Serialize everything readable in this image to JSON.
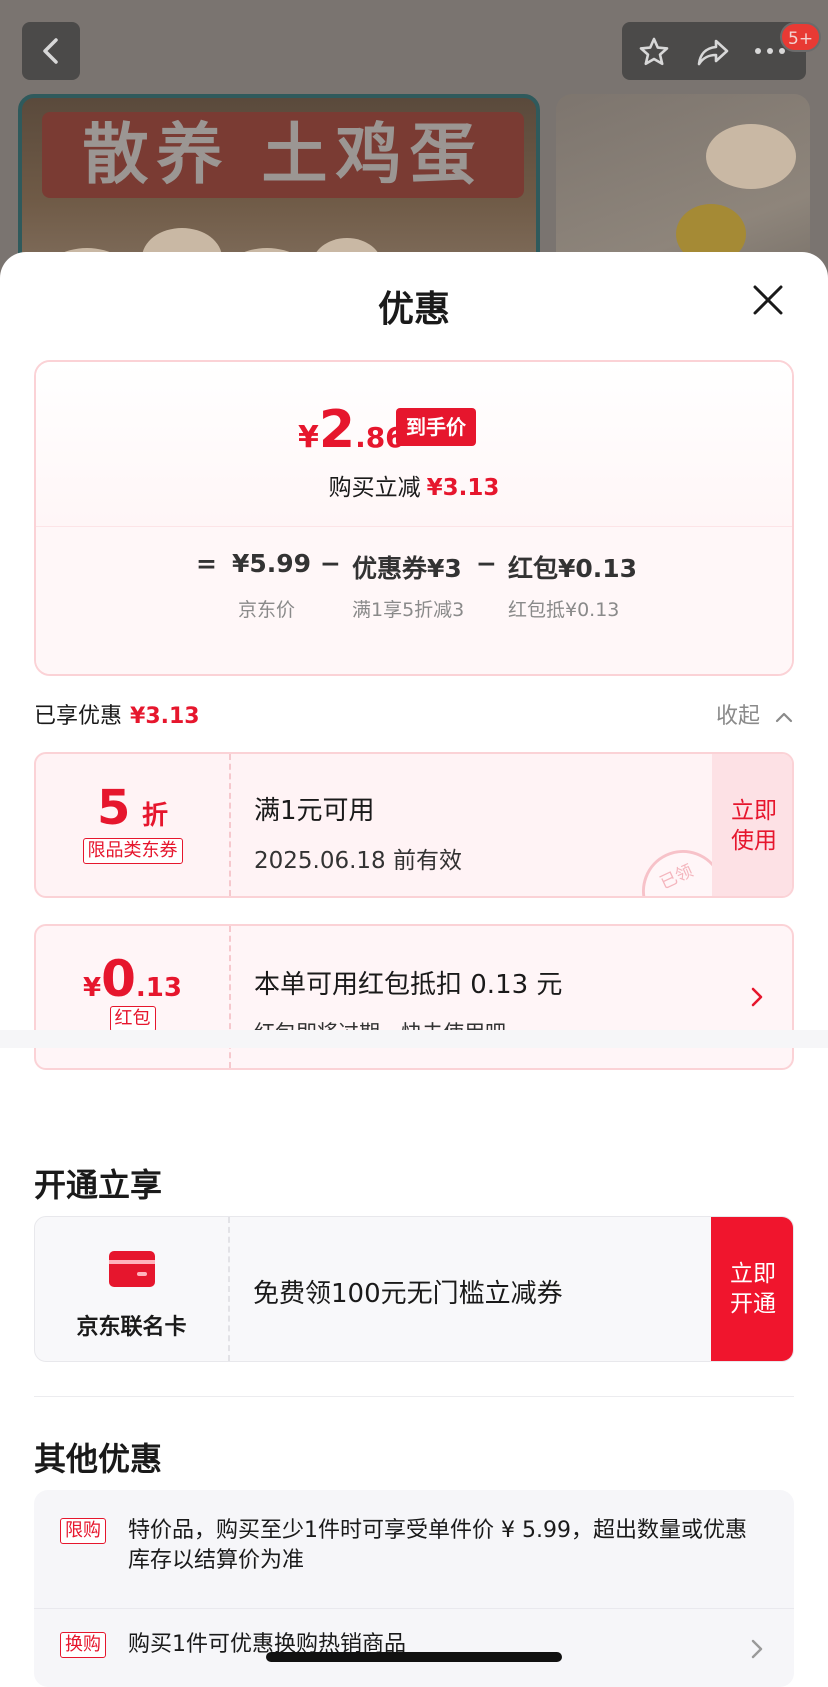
{
  "background": {
    "banner_text": "散养 土鸡蛋",
    "badge": "5+",
    "icons": [
      "chevron-left-icon",
      "star-icon",
      "share-icon",
      "more-icon"
    ]
  },
  "sheet": {
    "title": "优惠"
  },
  "price_card": {
    "yen": "¥",
    "price_int": "2",
    "price_dec": ".86",
    "final_tag": "到手价",
    "reduce_label": "购买立减",
    "reduce_amount": "¥3.13",
    "formula": {
      "equals": "=",
      "item1": "¥5.99",
      "op1": "−",
      "item2": "优惠券¥3",
      "op2": "−",
      "item3": "红包¥0.13",
      "sub1": "京东价",
      "sub2": "满1享5折减3",
      "sub3": "红包抵¥0.13"
    }
  },
  "enjoyed": {
    "label": "已享优惠",
    "amount": "¥3.13",
    "collapse_label": "收起"
  },
  "coupon1": {
    "value": "5",
    "unit": "折",
    "tag": "限品类东券",
    "title": "满1元可用",
    "valid": "2025.06.18 前有效",
    "action": "立即使用",
    "stamp": "已领"
  },
  "coupon2": {
    "yen": "¥",
    "value_int": "0",
    "value_dec": ".13",
    "tag": "红包",
    "title": "本单可用红包抵扣 0.13 元",
    "sub": "红包即将过期，快去使用吧 ~"
  },
  "open_section": {
    "title": "开通立享",
    "card_name": "京东联名卡",
    "desc": "免费领100元无门槛立减券",
    "action": "立即开通"
  },
  "other_section": {
    "title": "其他优惠",
    "rows": [
      {
        "tag": "限购",
        "text": "特价品，购买至少1件时可享受单件价 ¥ 5.99，超出数量或优惠库存以结算价为准"
      },
      {
        "tag": "换购",
        "text": "购买1件可优惠换购热销商品"
      }
    ]
  },
  "colors": {
    "accent": "#e6162d",
    "coupon_bg": "#fff3f5",
    "coupon_border": "#fbd2d6"
  }
}
